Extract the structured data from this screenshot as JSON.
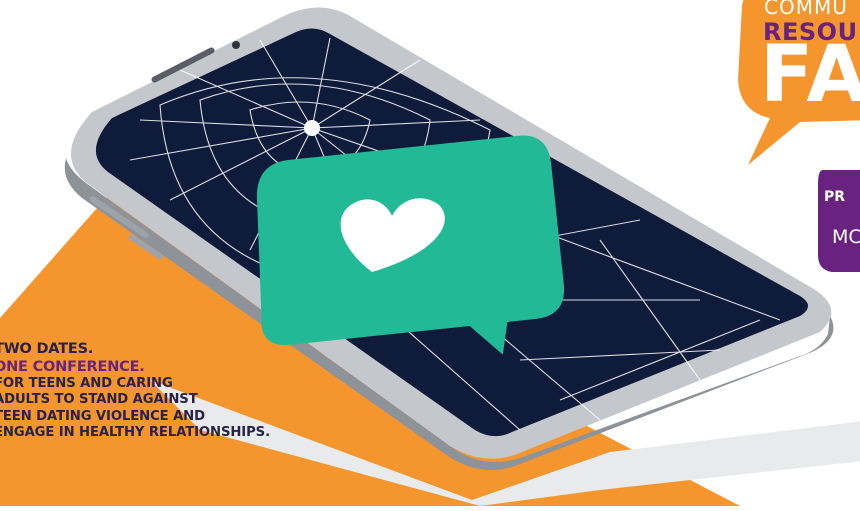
{
  "colors": {
    "orange": "#f4962d",
    "purple": "#6a2280",
    "teal": "#22b996",
    "screen": "#0e1b3a",
    "phone_body": "#b9bcc2",
    "text_dark": "#2a2148"
  },
  "flyer": {
    "headline_line1": "TWO DATES.",
    "headline_line2": "ONE CONFERENCE.",
    "description_lines": [
      "FOR TEENS AND CARING",
      "ADULTS TO STAND AGAINST",
      "TEEN DATING VIOLENCE AND",
      "ENGAGE IN HEALTHY RELATIONSHIPS."
    ]
  },
  "speech_bubble": {
    "line1": "COMMU",
    "line2": "RESOU",
    "line3": "FA"
  },
  "purple_tag": {
    "line1": "PR",
    "line2": "MC"
  },
  "phone": {
    "app_icon": "heart-chat-icon",
    "screen_state": "cracked"
  }
}
